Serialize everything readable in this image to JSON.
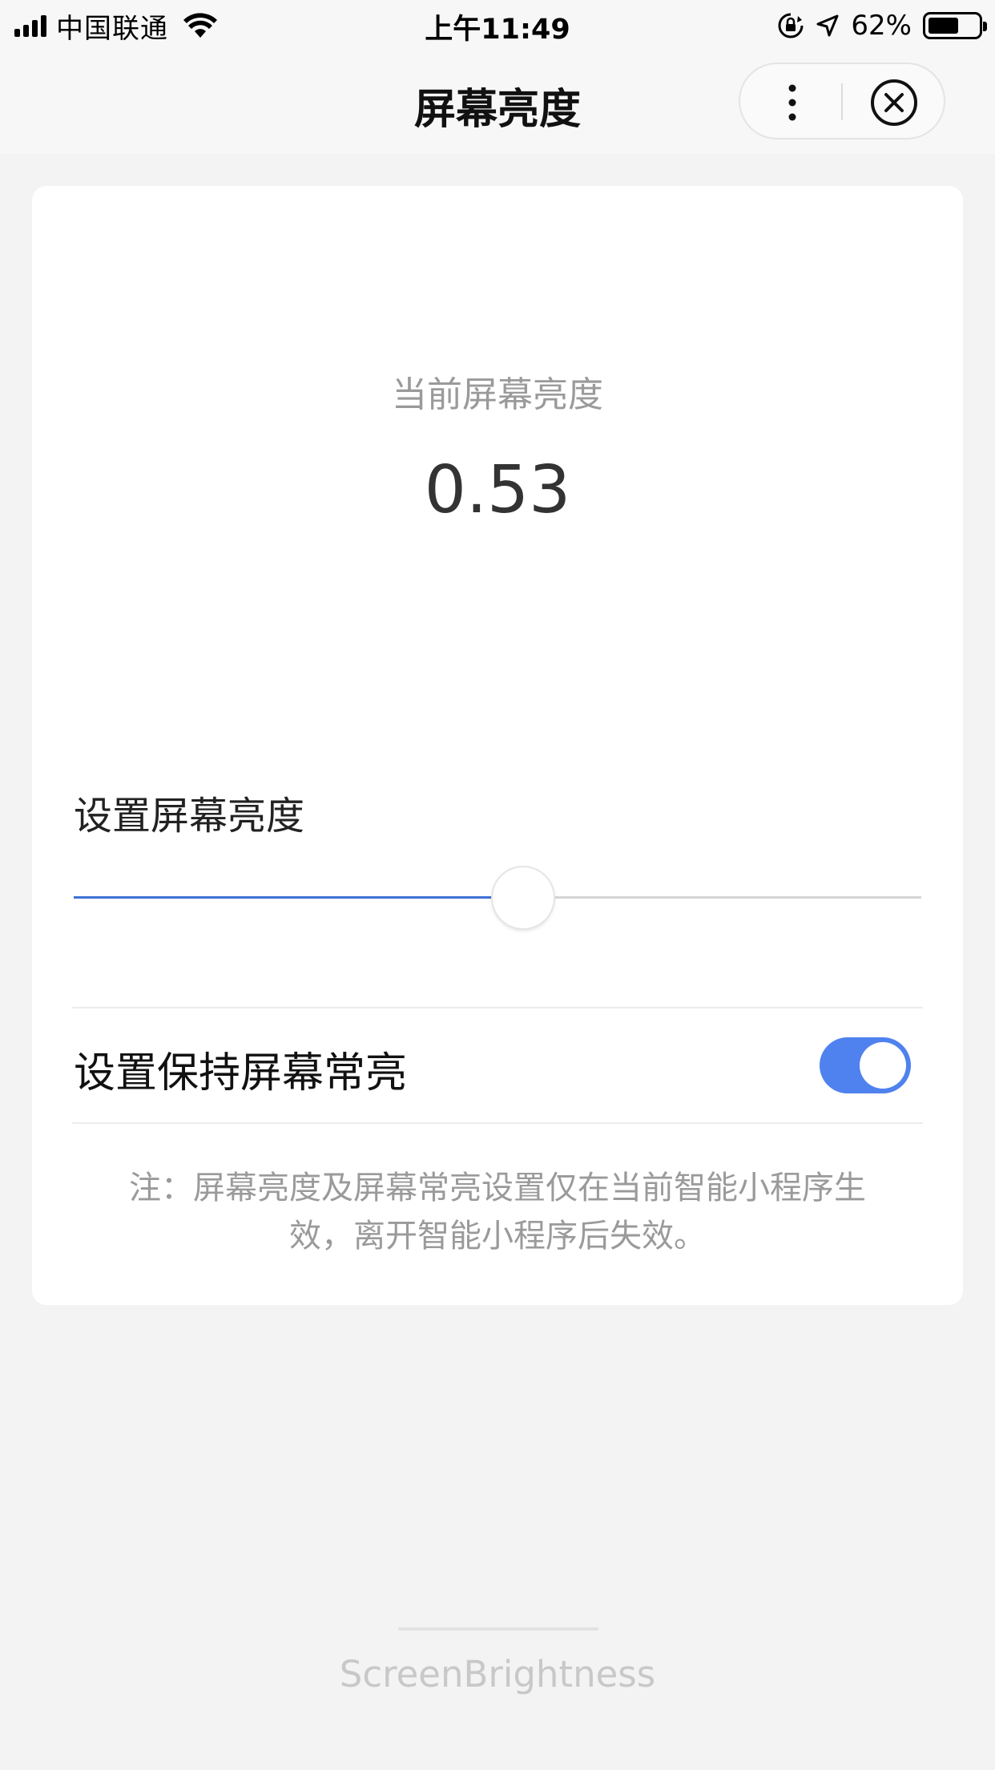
{
  "status_bar": {
    "carrier": "中国联通",
    "time": "上午11:49",
    "battery_percent": "62%",
    "battery_level": 0.62,
    "icons": [
      "signal-icon",
      "wifi-icon",
      "orientation-lock-icon",
      "location-icon",
      "battery-icon"
    ]
  },
  "nav": {
    "title": "屏幕亮度",
    "icons": [
      "more-icon",
      "close-icon"
    ]
  },
  "brightness": {
    "current_label": "当前屏幕亮度",
    "current_value": "0.53",
    "set_label": "设置屏幕亮度",
    "slider_value": 0.53,
    "accent_color": "#3f72d6"
  },
  "keep_on": {
    "label": "设置保持屏幕常亮",
    "enabled": true,
    "switch_color": "#4f82ee"
  },
  "note": {
    "line1": "注：屏幕亮度及屏幕常亮设置仅在当前智能小程序生",
    "line2": "效，离开智能小程序后失效。"
  },
  "footer": {
    "app_name": "ScreenBrightness"
  }
}
